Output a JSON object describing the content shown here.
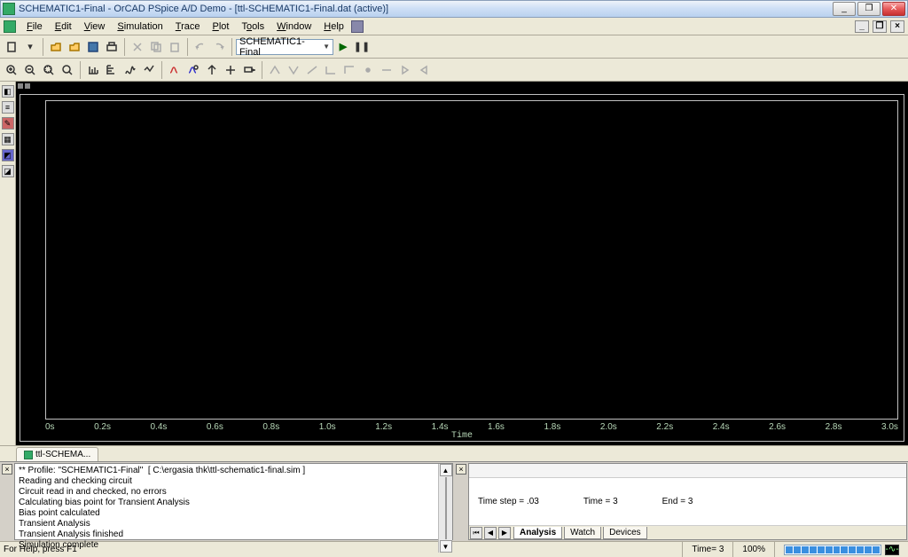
{
  "window": {
    "title": "SCHEMATIC1-Final - OrCAD PSpice A/D Demo - [ttl-SCHEMATIC1-Final.dat (active)]"
  },
  "menu": [
    "File",
    "Edit",
    "View",
    "Simulation",
    "Trace",
    "Plot",
    "Tools",
    "Window",
    "Help"
  ],
  "toolbar1": {
    "combo": "SCHEMATIC1-Final"
  },
  "plot": {
    "xlabel": "Time",
    "xticks": [
      "0s",
      "0.2s",
      "0.4s",
      "0.6s",
      "0.8s",
      "1.0s",
      "1.2s",
      "1.4s",
      "1.6s",
      "1.8s",
      "2.0s",
      "2.2s",
      "2.4s",
      "2.6s",
      "2.8s",
      "3.0s"
    ]
  },
  "doctab": "ttl-SCHEMA...",
  "log": {
    "lines": [
      "** Profile: \"SCHEMATIC1-Final\"  [ C:\\ergasia thk\\ttl-schematic1-final.sim ]",
      "Reading and checking circuit",
      "Circuit read in and checked, no errors",
      "Calculating bias point for Transient Analysis",
      "Bias point calculated",
      "Transient Analysis",
      "Transient Analysis finished",
      "Simulation complete"
    ]
  },
  "simstatus": {
    "timestep": "Time step = .03",
    "time": "Time = 3",
    "end": "End = 3",
    "tabs": [
      "Analysis",
      "Watch",
      "Devices"
    ]
  },
  "statusbar": {
    "help": "For Help, press F1",
    "time": "Time= 3",
    "pct": "100%"
  },
  "chart_data": {
    "type": "line",
    "title": "",
    "xlabel": "Time",
    "ylabel": "",
    "xlim": [
      0,
      3
    ],
    "x_unit": "s",
    "series": [],
    "note": "Plot area is empty (no traces added); x-axis ticks every 0.2s from 0s to 3.0s"
  }
}
